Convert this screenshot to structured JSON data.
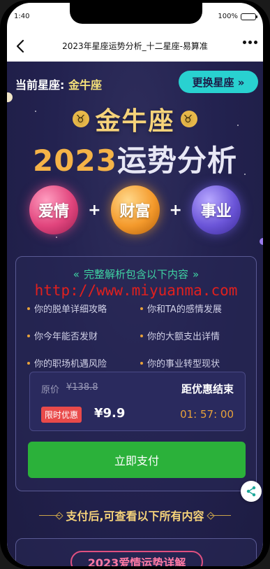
{
  "status_bar": {
    "time": "1:40",
    "battery_text": "100%",
    "battery_level": 1.0
  },
  "nav": {
    "title": "2023年星座运势分析_十二星座-易算准",
    "back_icon": "chevron-left-icon",
    "more_icon": "more-dots-icon"
  },
  "header": {
    "current_label": "当前星座:",
    "current_sign": "金牛座",
    "change_button": "更换星座 »"
  },
  "hero": {
    "sign_title": "金牛座",
    "sign_symbol": "♉",
    "year": "2023",
    "year_title_rest": "运势分析",
    "topics": [
      "爱情",
      "财富",
      "事业"
    ],
    "plus": "+"
  },
  "card": {
    "heading": "完整解析包含以下内容",
    "watermark": "http://www.miyuanma.com",
    "items": [
      "你的脱单详细攻略",
      "你和TA的感情发展",
      "你今年能否发财",
      "你的大额支出详情",
      "你的职场机遇风险",
      "你的事业转型现状"
    ],
    "price": {
      "orig_label": "原价",
      "orig_price": "¥138.8",
      "countdown_label": "距优惠结束",
      "promo_tag": "限时优惠",
      "sale_price": "¥9.9",
      "countdown": "01: 57: 00"
    },
    "pay_button": "立即支付"
  },
  "after_pay_text": "支付后,可查看以下所有内容",
  "love_section_title": "2023爱情运势详解",
  "colors": {
    "background": "#232250",
    "accent_gold": "#f6d37a",
    "accent_cyan": "#29d1d0",
    "pay_green": "#2bb13a",
    "promo_red": "#e94a4a",
    "heading_green": "#3fd3a3"
  }
}
